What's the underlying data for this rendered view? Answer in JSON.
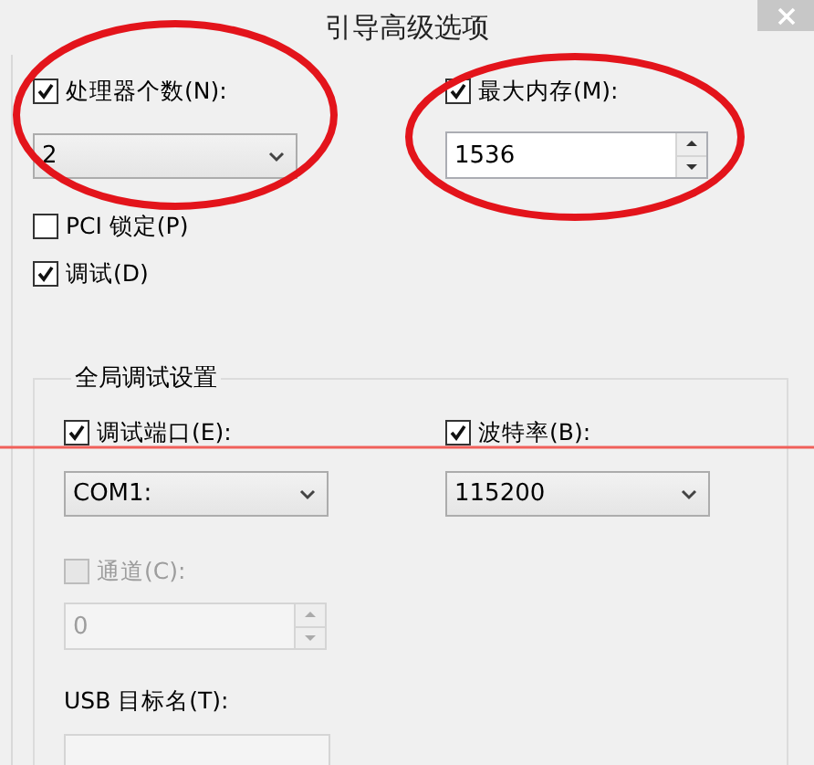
{
  "window": {
    "title": "引导高级选项"
  },
  "processors": {
    "label": "处理器个数(N):",
    "checked": true,
    "value": "2"
  },
  "max_memory": {
    "label": "最大内存(M):",
    "checked": true,
    "value": "1536"
  },
  "pci_lock": {
    "label": "PCI 锁定(P)",
    "checked": false
  },
  "debug": {
    "label": "调试(D)",
    "checked": true
  },
  "global_debug": {
    "title": "全局调试设置",
    "debug_port": {
      "label": "调试端口(E):",
      "checked": true,
      "value": "COM1:"
    },
    "baud_rate": {
      "label": "波特率(B):",
      "checked": true,
      "value": "115200"
    },
    "channel": {
      "label": "通道(C):",
      "checked": false,
      "disabled": true,
      "value": "0"
    },
    "usb_target": {
      "label": "USB 目标名(T):"
    }
  },
  "annotations": [
    {
      "kind": "ellipse"
    },
    {
      "kind": "ellipse"
    },
    {
      "kind": "line"
    }
  ]
}
